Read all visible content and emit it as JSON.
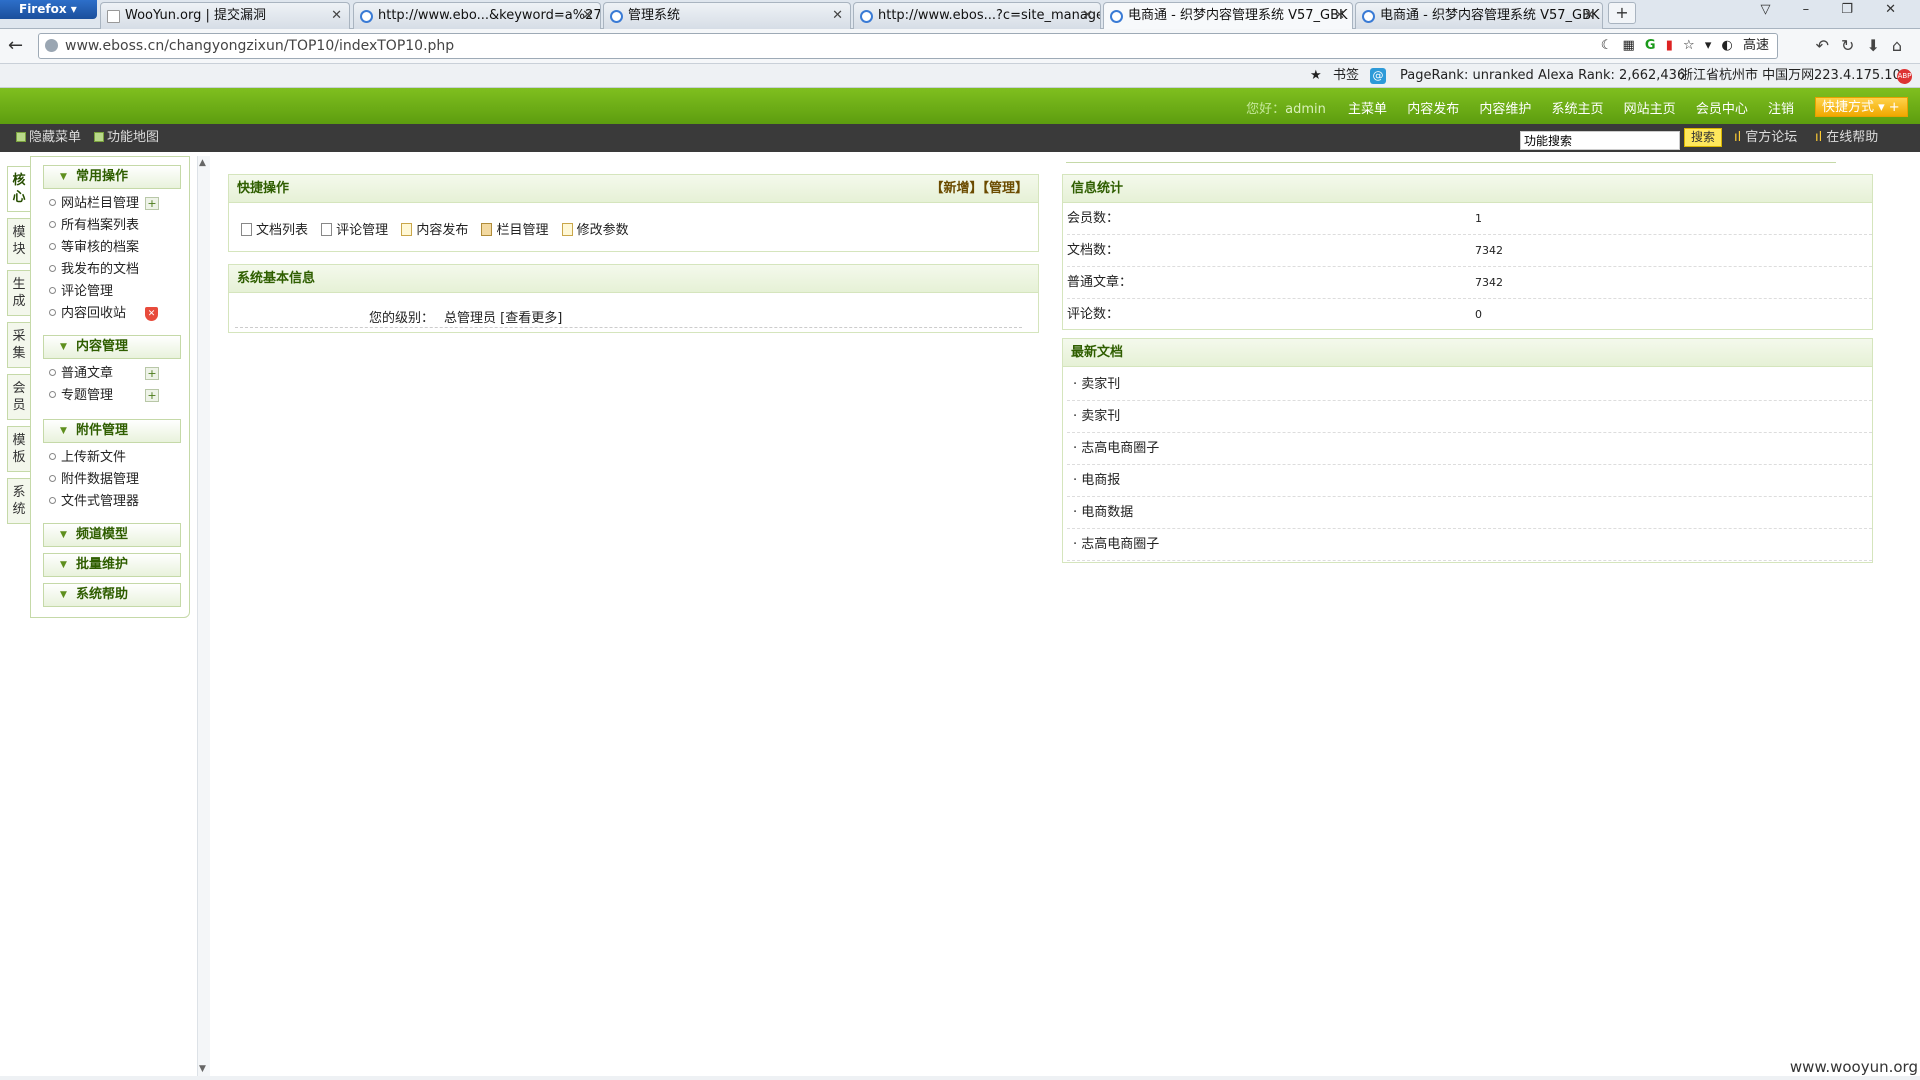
{
  "browser": {
    "app_button": "Firefox",
    "tabs": [
      {
        "title": "WooYun.org | 提交漏洞",
        "active": false
      },
      {
        "title": "http://www.ebo...&keyword=a%27",
        "active": false
      },
      {
        "title": "管理系统",
        "active": false
      },
      {
        "title": "http://www.ebos...?c=site_manage",
        "active": false
      },
      {
        "title": "电商通 - 织梦内容管理系统 V57_GBK",
        "active": true
      },
      {
        "title": "电商通 - 织梦内容管理系统 V57_GBK",
        "active": false
      }
    ],
    "url": "www.eboss.cn/changyongzixun/TOP10/indexTOP10.php",
    "url_right_label": "高速",
    "addon": {
      "bookmark": "书签",
      "pagerank": "PageRank: unranked",
      "alexa": "Alexa Rank: 2,662,436",
      "location": "浙江省杭州市 中国万网",
      "ip": "223.4.175.10"
    }
  },
  "header": {
    "greeting_prefix": "您好：",
    "user": "admin",
    "nav": [
      "主菜单",
      "内容发布",
      "内容维护",
      "系统主页",
      "网站主页",
      "会员中心",
      "注销"
    ],
    "quick": "快捷方式"
  },
  "subbar": {
    "hide_menu": "隐藏菜单",
    "site_map": "功能地图",
    "search_value": "功能搜索",
    "search_button": "搜索",
    "forum": "官方论坛",
    "help": "在线帮助"
  },
  "vtabs": [
    {
      "label": "核心",
      "chars": [
        "核",
        "心"
      ],
      "active": true
    },
    {
      "label": "模块",
      "chars": [
        "模",
        "块"
      ],
      "active": false
    },
    {
      "label": "生成",
      "chars": [
        "生",
        "成"
      ],
      "active": false
    },
    {
      "label": "采集",
      "chars": [
        "采",
        "集"
      ],
      "active": false
    },
    {
      "label": "会员",
      "chars": [
        "会",
        "员"
      ],
      "active": false
    },
    {
      "label": "模板",
      "chars": [
        "模",
        "板"
      ],
      "active": false
    },
    {
      "label": "系统",
      "chars": [
        "系",
        "统"
      ],
      "active": false
    }
  ],
  "menu": {
    "groups": [
      {
        "title": "常用操作",
        "items": [
          "网站栏目管理",
          "所有档案列表",
          "等审核的档案",
          "我发布的文档",
          "评论管理",
          "内容回收站"
        ]
      },
      {
        "title": "内容管理",
        "items": [
          "普通文章",
          "专题管理"
        ]
      },
      {
        "title": "附件管理",
        "items": [
          "上传新文件",
          "附件数据管理",
          "文件式管理器"
        ]
      },
      {
        "title": "频道模型",
        "items": []
      },
      {
        "title": "批量维护",
        "items": []
      },
      {
        "title": "系统帮助",
        "items": []
      }
    ]
  },
  "quick_ops": {
    "title": "快捷操作",
    "actions_right": "【新增】【管理】",
    "links": [
      "文档列表",
      "评论管理",
      "内容发布",
      "栏目管理",
      "修改参数"
    ]
  },
  "sys_info": {
    "title": "系统基本信息",
    "level_label": "您的级别：",
    "level_value": "总管理员",
    "more": "[查看更多]"
  },
  "stats": {
    "title": "信息统计",
    "rows": [
      {
        "label": "会员数：",
        "value": "1"
      },
      {
        "label": "文档数：",
        "value": "7342"
      },
      {
        "label": "普通文章：",
        "value": "7342"
      },
      {
        "label": "评论数：",
        "value": "0"
      }
    ]
  },
  "latest": {
    "title": "最新文档",
    "items": [
      "· 卖家刊",
      "· 卖家刊",
      "· 志高电商圈子",
      "· 电商报",
      "· 电商数据",
      "· 志高电商圈子"
    ]
  },
  "watermark": "www.wooyun.org"
}
